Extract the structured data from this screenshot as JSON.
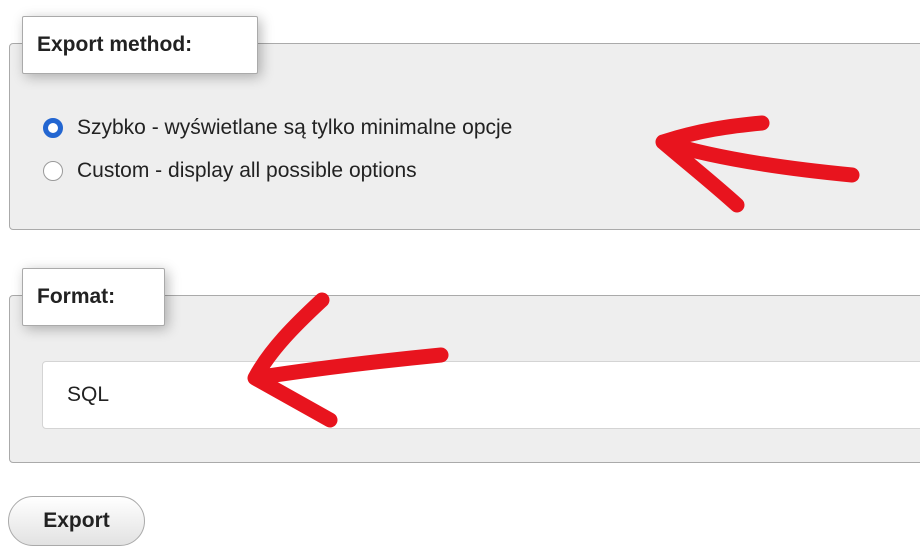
{
  "export_method": {
    "legend": "Export method:",
    "options": [
      {
        "label": "Szybko - wyświetlane są tylko minimalne opcje",
        "selected": true
      },
      {
        "label": "Custom - display all possible options",
        "selected": false
      }
    ]
  },
  "format": {
    "legend": "Format:",
    "selected_value": "SQL"
  },
  "export_button": {
    "label": "Export"
  },
  "colors": {
    "annotation_arrow": "#e8141e",
    "radio_selected": "#2366d1",
    "panel_background": "#eeeeee"
  }
}
